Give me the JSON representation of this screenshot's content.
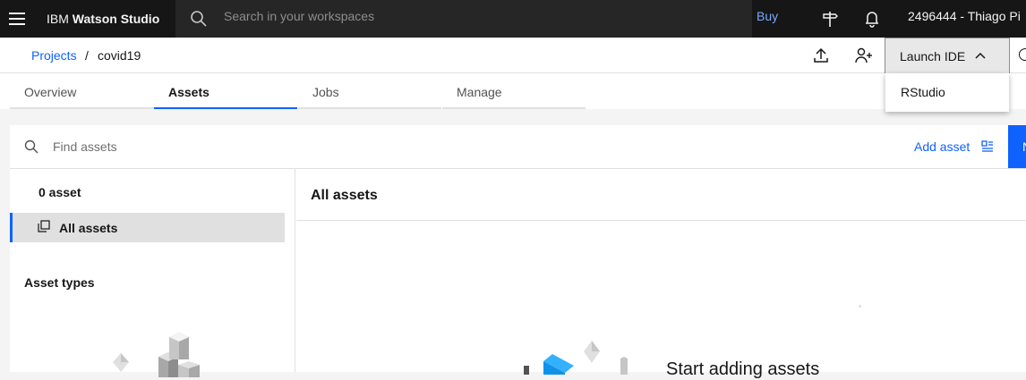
{
  "topbar": {
    "brand_prefix": "IBM",
    "brand_name": "Watson Studio",
    "search_placeholder": "Search in your workspaces",
    "buy_label": "Buy",
    "account_label": "2496444 - Thiago Pi"
  },
  "breadcrumb": {
    "projects_label": "Projects",
    "separator": "/",
    "current": "covid19"
  },
  "header": {
    "launch_ide_label": "Launch IDE",
    "dropdown_options": [
      "RStudio"
    ]
  },
  "tabs": [
    {
      "label": "Overview",
      "active": false
    },
    {
      "label": "Assets",
      "active": true
    },
    {
      "label": "Jobs",
      "active": false
    },
    {
      "label": "Manage",
      "active": false
    }
  ],
  "assets": {
    "find_placeholder": "Find assets",
    "add_asset_label": "Add asset",
    "new_button_label": "N",
    "count_label": "0 asset",
    "all_assets_label": "All assets",
    "asset_types_label": "Asset types",
    "main_title": "All assets",
    "empty_title": "Start adding assets"
  },
  "colors": {
    "topbar_bg": "#161616",
    "accent": "#0f62fe",
    "link": "#0f62fe",
    "buy": "#78a9ff"
  },
  "icons": [
    "hamburger-icon",
    "search-icon",
    "signpost-icon",
    "notification-icon",
    "upload-icon",
    "add-collaborator-icon",
    "chevron-up-icon",
    "copy-icon",
    "add-asset-icon"
  ]
}
